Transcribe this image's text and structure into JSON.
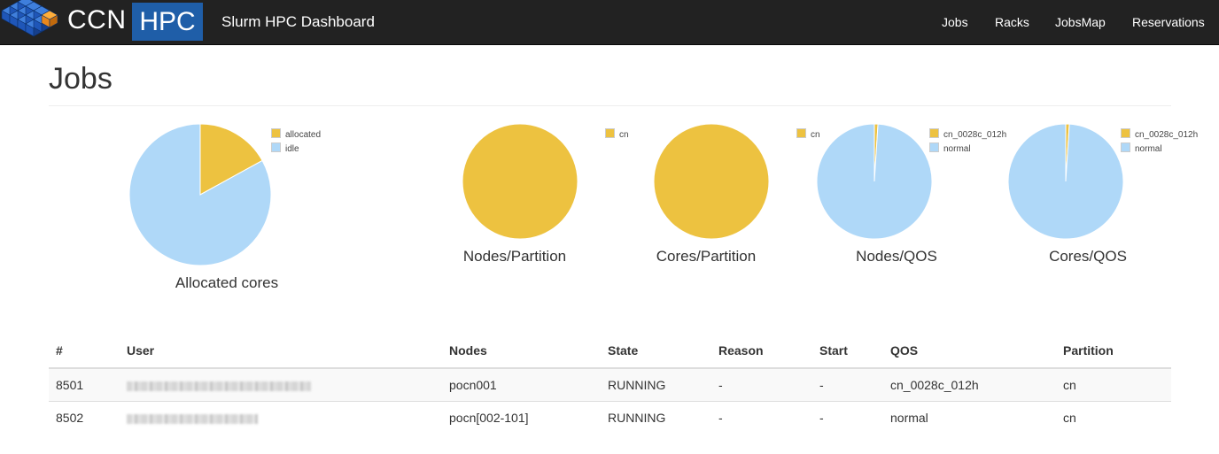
{
  "navbar": {
    "brand_left": "CCN",
    "brand_right": "HPC",
    "app_title": "Slurm HPC Dashboard",
    "links": [
      "Jobs",
      "Racks",
      "JobsMap",
      "Reservations"
    ],
    "brand_blue": "#1f5ea8",
    "logo_icon": "cube-grid-logo-icon"
  },
  "page": {
    "title": "Jobs"
  },
  "colors": {
    "allocated": "#edc240",
    "idle": "#afd8f8"
  },
  "chart_data": [
    {
      "type": "pie",
      "title": "Allocated cores",
      "labels": [
        "allocated",
        "idle"
      ],
      "values": [
        17,
        83
      ]
    },
    {
      "type": "pie",
      "title": "Nodes/Partition",
      "labels": [
        "cn"
      ],
      "values": [
        100
      ]
    },
    {
      "type": "pie",
      "title": "Cores/Partition",
      "labels": [
        "cn"
      ],
      "values": [
        100
      ]
    },
    {
      "type": "pie",
      "title": "Nodes/QOS",
      "labels": [
        "cn_0028c_012h",
        "normal"
      ],
      "values": [
        1,
        99
      ]
    },
    {
      "type": "pie",
      "title": "Cores/QOS",
      "labels": [
        "cn_0028c_012h",
        "normal"
      ],
      "values": [
        1,
        99
      ]
    }
  ],
  "table": {
    "headers": [
      "#",
      "User",
      "Nodes",
      "State",
      "Reason",
      "Start",
      "QOS",
      "Partition"
    ],
    "rows": [
      {
        "id": "8501",
        "user": "",
        "nodes": "pocn001",
        "state": "RUNNING",
        "reason": "-",
        "start": "-",
        "qos": "cn_0028c_012h",
        "partition": "cn"
      },
      {
        "id": "8502",
        "user": "",
        "nodes": "pocn[002-101]",
        "state": "RUNNING",
        "reason": "-",
        "start": "-",
        "qos": "normal",
        "partition": "cn"
      }
    ]
  }
}
